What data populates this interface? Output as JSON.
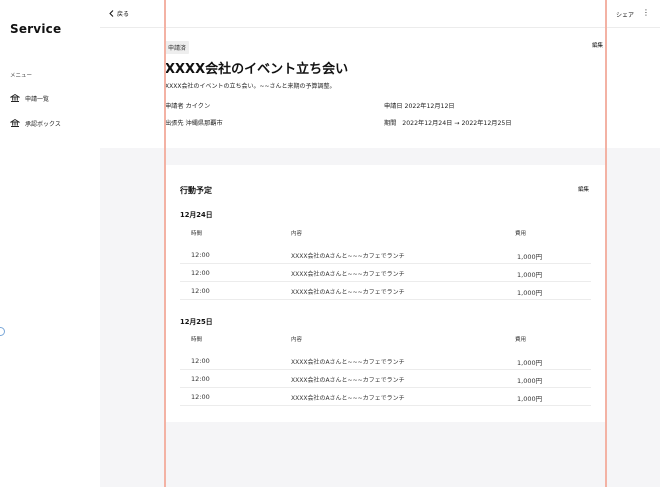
{
  "sidebar": {
    "brand": "Service",
    "menu_heading": "メニュー",
    "items": [
      {
        "label": "申請一覧",
        "icon": "bank-icon"
      },
      {
        "label": "承認ボックス",
        "icon": "bank-icon"
      }
    ]
  },
  "topbar": {
    "back_label": "戻る",
    "share_label": "シェア",
    "more_icon": "kebab-icon"
  },
  "detail": {
    "status_badge": "申請済",
    "edit_label": "編集",
    "title": "XXXX会社のイベント立ち会い",
    "description": "XXXX会社のイベントの立ち会い。~~さんと来期の予算調整。",
    "applicant_label": "申請者",
    "applicant": "カイクン",
    "date_label": "申請日",
    "date": "2022年12月12日",
    "destination_label": "出張先",
    "destination": "沖縄県那覇市",
    "period_label": "期間",
    "period": "2022年12月24日 → 2022年12月25日"
  },
  "schedule": {
    "title": "行動予定",
    "edit_label": "編集",
    "columns": [
      "時間",
      "内容",
      "費用"
    ],
    "days": [
      {
        "date": "12月24日",
        "rows": [
          {
            "time": "12:00",
            "content": "XXXX会社のAさんと~~~カフェでランチ",
            "cost": "1,000円"
          },
          {
            "time": "12:00",
            "content": "XXXX会社のAさんと~~~カフェでランチ",
            "cost": "1,000円"
          },
          {
            "time": "12:00",
            "content": "XXXX会社のAさんと~~~カフェでランチ",
            "cost": "1,000円"
          }
        ]
      },
      {
        "date": "12月25日",
        "rows": [
          {
            "time": "12:00",
            "content": "XXXX会社のAさんと~~~カフェでランチ",
            "cost": "1,000円"
          },
          {
            "time": "12:00",
            "content": "XXXX会社のAさんと~~~カフェでランチ",
            "cost": "1,000円"
          },
          {
            "time": "12:00",
            "content": "XXXX会社のAさんと~~~カフェでランチ",
            "cost": "1,000円"
          }
        ]
      }
    ]
  },
  "colors": {
    "guide": "#f3b2a4",
    "background": "#f5f5f7",
    "panel": "#ffffff"
  }
}
